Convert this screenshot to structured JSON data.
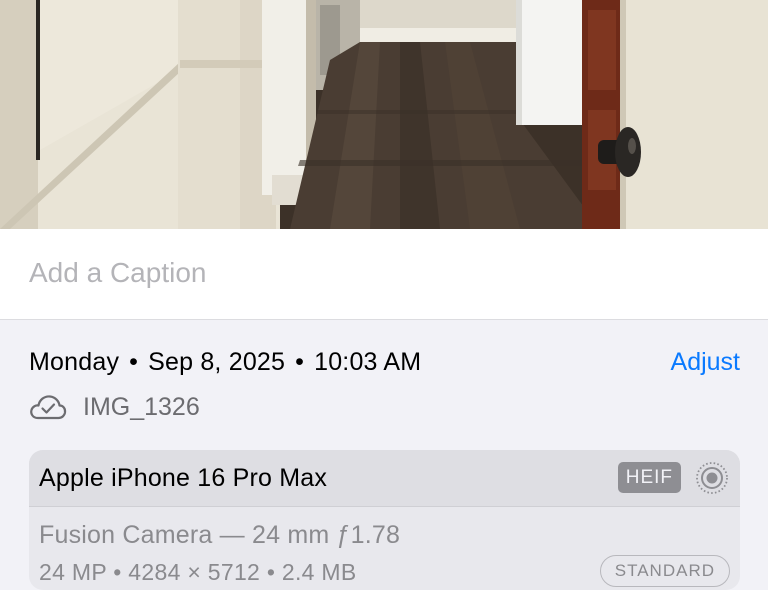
{
  "photo": {
    "alt": "Photo of a hallway with wood floor, open door and dark door knob"
  },
  "caption": {
    "placeholder": "Add a Caption",
    "value": ""
  },
  "info": {
    "date": {
      "day": "Monday",
      "separator": "•",
      "date": "Sep 8, 2025",
      "time": "10:03 AM"
    },
    "adjust_label": "Adjust",
    "filename": "IMG_1326",
    "icon": "cloud-checkmark-icon"
  },
  "device": {
    "name": "Apple iPhone 16 Pro Max",
    "format_badge": "HEIF",
    "live_icon": "live-photo-icon",
    "camera": "Fusion Camera — 24 mm ƒ1.78",
    "specs": "24 MP • 4284 × 5712 • 2.4 MB",
    "style_badge": "STANDARD"
  },
  "colors": {
    "accent": "#0a7aff",
    "background": "#f2f2f7",
    "secondary_text": "#8a8a8e"
  }
}
